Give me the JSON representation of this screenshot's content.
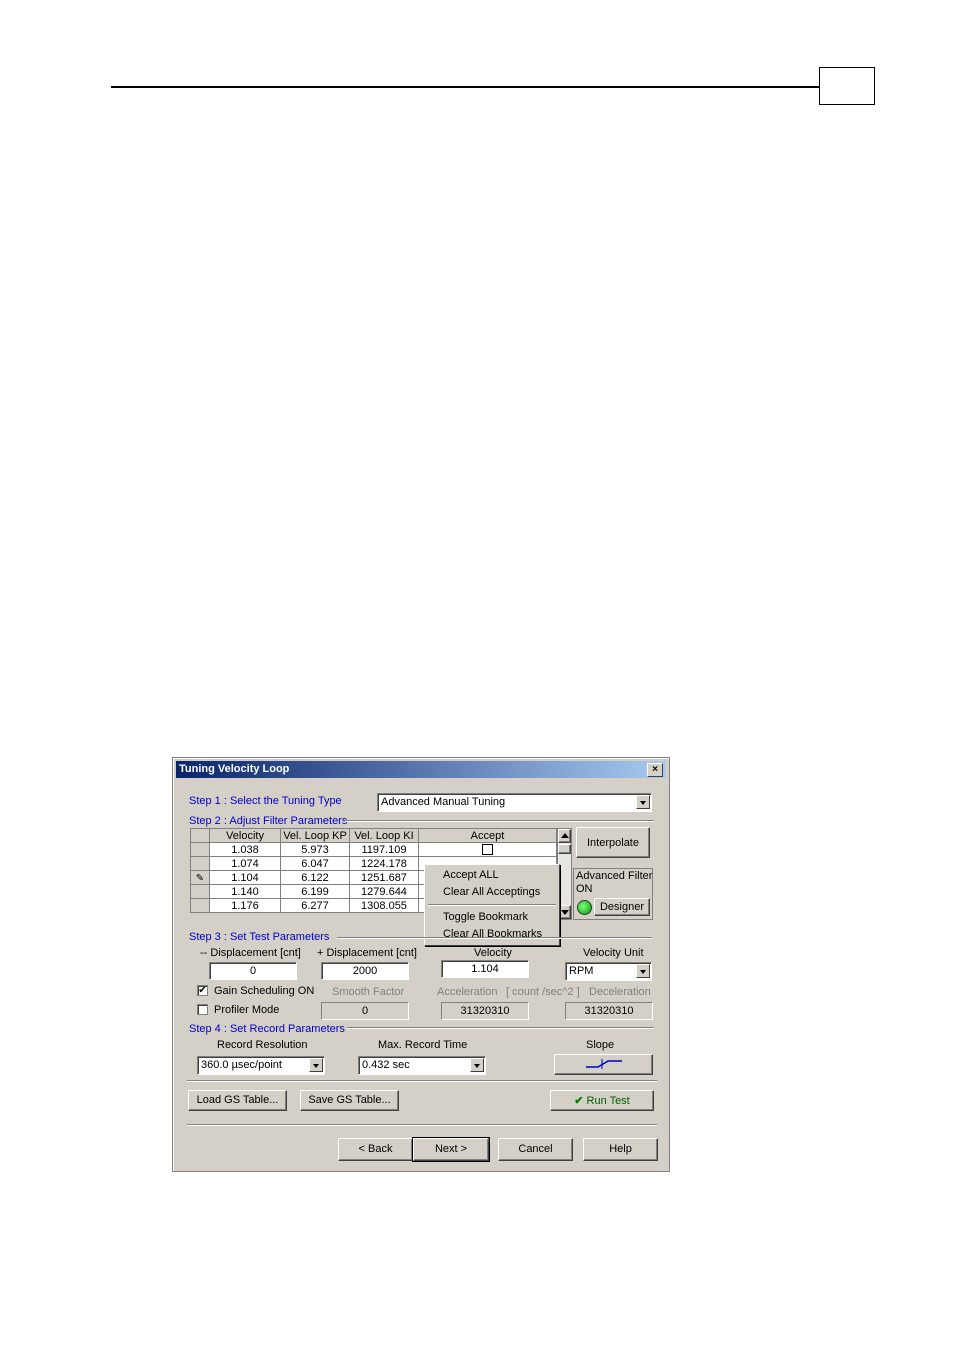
{
  "page": {
    "box_text": ""
  },
  "dialog": {
    "title": "Tuning Velocity Loop",
    "close": "×",
    "step1": {
      "label": "Step 1 : Select the  Tuning Type",
      "tuning_type": "Advanced Manual Tuning"
    },
    "step2": {
      "label": "Step 2 :  Adjust Filter Parameters",
      "columns": [
        "Velocity",
        "Vel. Loop KP",
        "Vel. Loop KI",
        "Accept"
      ],
      "rows": [
        [
          "1.038",
          "5.973",
          "1197.109"
        ],
        [
          "1.074",
          "6.047",
          "1224.178"
        ],
        [
          "1.104",
          "6.122",
          "1251.687"
        ],
        [
          "1.140",
          "6.199",
          "1279.644"
        ],
        [
          "1.176",
          "6.277",
          "1308.055"
        ]
      ],
      "interpolate": "Interpolate",
      "advanced_filter": "Advanced Filter",
      "on": "ON",
      "designer": "Designer"
    },
    "context_menu": {
      "accept_all": "Accept ALL",
      "clear_accept": "Clear All Acceptings",
      "toggle_bookmark": "Toggle Bookmark",
      "clear_bookmarks": "Clear All Bookmarks"
    },
    "step3": {
      "label": "Step 3 : Set Test  Parameters",
      "minus_disp_label": "-- Displacement [cnt]",
      "minus_disp": "0",
      "plus_disp_label": "+ Displacement [cnt]",
      "plus_disp": "2000",
      "velocity_label": "Velocity",
      "velocity": "1.104",
      "unit_label": "Velocity Unit",
      "unit": "RPM",
      "gain_sched": "Gain Scheduling ON",
      "profiler": "Profiler Mode",
      "smooth_label": "Smooth Factor",
      "smooth": "0",
      "accel_label": "Acceleration",
      "units_label": "[ count /sec^2 ]",
      "decel_label": "Deceleration",
      "accel": "31320310",
      "decel": "31320310"
    },
    "step4": {
      "label": "Step 4 : Set Record Parameters",
      "res_label": "Record Resolution",
      "res": "360.0 µsec/point",
      "time_label": "Max. Record Time",
      "time": "0.432 sec",
      "slope_label": "Slope"
    },
    "buttons": {
      "load": "Load GS Table...",
      "save": "Save GS Table...",
      "run": "Run Test",
      "back": "< Back",
      "next": "Next >",
      "cancel": "Cancel",
      "help": "Help"
    }
  }
}
